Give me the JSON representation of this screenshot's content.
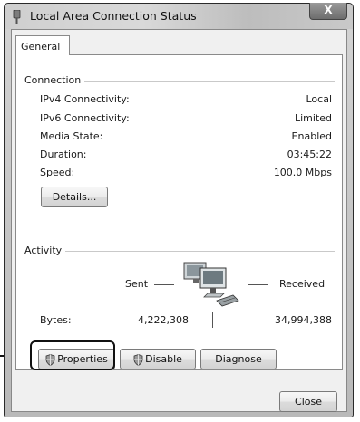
{
  "window": {
    "title": "Local Area Connection Status",
    "close_glyph": "X"
  },
  "tabs": [
    "General"
  ],
  "connection": {
    "group_label": "Connection",
    "rows": [
      {
        "label": "IPv4 Connectivity:",
        "value": "Local"
      },
      {
        "label": "IPv6 Connectivity:",
        "value": "Limited"
      },
      {
        "label": "Media State:",
        "value": "Enabled"
      },
      {
        "label": "Duration:",
        "value": "03:45:22"
      },
      {
        "label": "Speed:",
        "value": "100.0 Mbps"
      }
    ],
    "details_button": "Details..."
  },
  "activity": {
    "group_label": "Activity",
    "sent_label": "Sent",
    "received_label": "Received",
    "bytes_label": "Bytes:",
    "bytes_sent": "4,222,308",
    "bytes_received": "34,994,388",
    "icon": "network-computer-icon"
  },
  "buttons": {
    "properties": "Properties",
    "disable": "Disable",
    "diagnose": "Diagnose",
    "close": "Close"
  },
  "icons": {
    "shield": "uac-shield-icon",
    "app": "network-adapter-icon"
  }
}
